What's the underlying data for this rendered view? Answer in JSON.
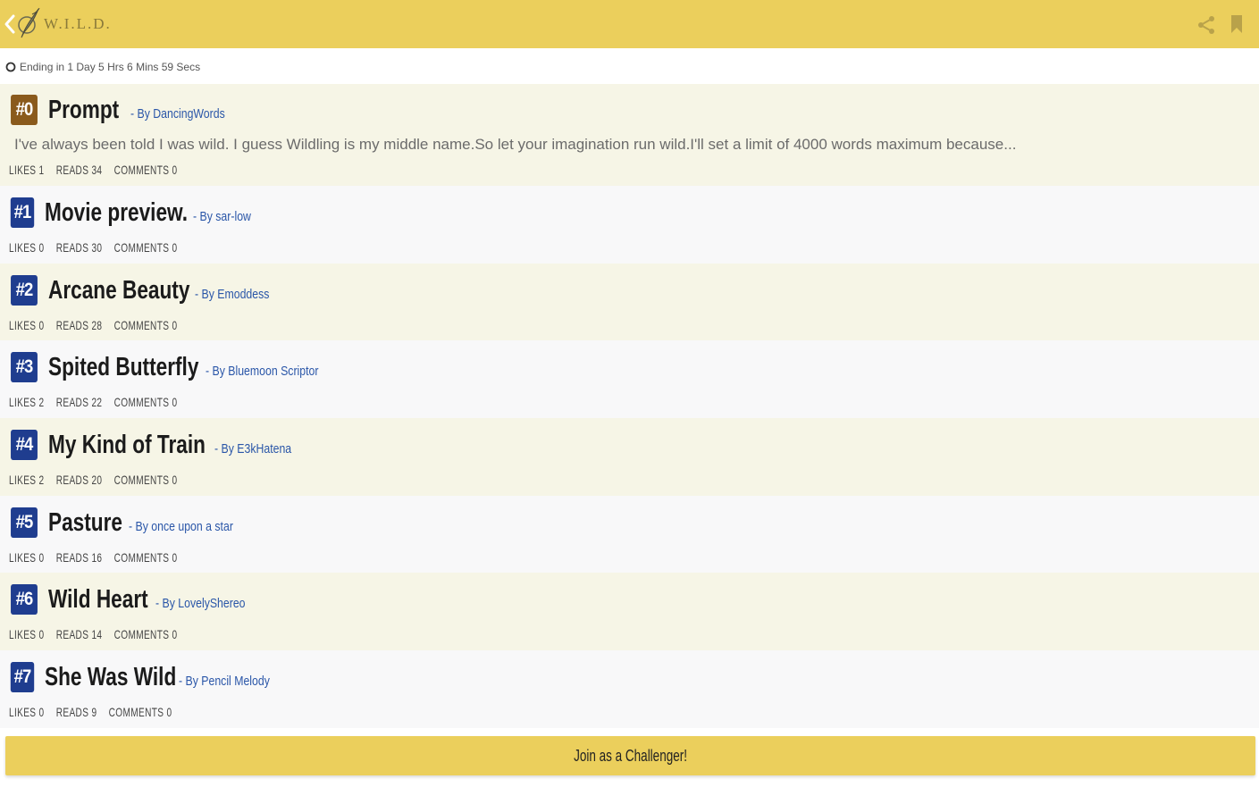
{
  "app": {
    "title": "W.I.L.D."
  },
  "icons": {
    "back": "chevron-left-icon",
    "logo": "quill-logo",
    "share": "share-icon",
    "bookmark": "bookmark-icon",
    "clock": "clock-icon"
  },
  "colors": {
    "brand_yellow": "#ebcf5c",
    "prompt_badge": "#8a5a1c",
    "challenger_badge": "#1f3d8f",
    "byline_blue": "#2a56a8"
  },
  "countdown": {
    "text": "Ending in 1 Day 5 Hrs 6 Mins 59 Secs"
  },
  "entries": [
    {
      "rank": "#0",
      "title": "Prompt",
      "byline": "- By DancingWords",
      "excerpt": "I've always been told I was wild. I guess Wildling is my middle name.So let your imagination run wild.I'll set a limit of 4000 words maximum because...",
      "likes": "LIKES 1",
      "reads": "READS 34",
      "comments": "COMMENTS 0"
    },
    {
      "rank": "#1",
      "title": "Movie preview.",
      "byline": "- By sar-low",
      "likes": "LIKES 0",
      "reads": "READS 30",
      "comments": "COMMENTS 0"
    },
    {
      "rank": "#2",
      "title": "Arcane Beauty",
      "byline": "- By Emoddess",
      "likes": "LIKES 0",
      "reads": "READS 28",
      "comments": "COMMENTS 0"
    },
    {
      "rank": "#3",
      "title": "Spited Butterfly",
      "byline": "- By Bluemoon Scriptor",
      "likes": "LIKES 2",
      "reads": "READS 22",
      "comments": "COMMENTS 0"
    },
    {
      "rank": "#4",
      "title": "My Kind of Train",
      "byline": "- By E3kHatena",
      "likes": "LIKES 2",
      "reads": "READS 20",
      "comments": "COMMENTS 0"
    },
    {
      "rank": "#5",
      "title": "Pasture",
      "byline": "- By once upon a star",
      "likes": "LIKES 0",
      "reads": "READS 16",
      "comments": "COMMENTS 0"
    },
    {
      "rank": "#6",
      "title": "Wild Heart",
      "byline": "- By LovelyShereo",
      "likes": "LIKES 0",
      "reads": "READS 14",
      "comments": "COMMENTS 0"
    },
    {
      "rank": "#7",
      "title": "She Was Wild",
      "byline": "- By Pencil Melody",
      "likes": "LIKES 0",
      "reads": "READS 9",
      "comments": "COMMENTS 0"
    }
  ],
  "join": {
    "label": "Join as a Challenger!"
  }
}
